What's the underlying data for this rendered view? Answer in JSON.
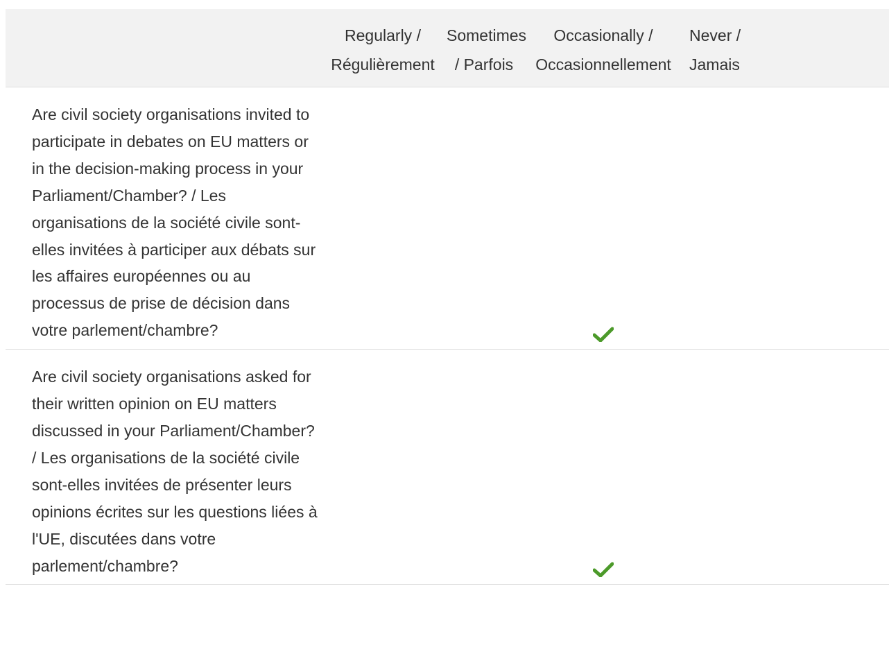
{
  "header": {
    "columns": [
      {
        "line1": "Regularly /",
        "line2": "Régulièrement"
      },
      {
        "line1": "Sometimes",
        "line2": "/ Parfois"
      },
      {
        "line1": "Occasionally /",
        "line2": "Occasionnellement"
      },
      {
        "line1": "Never /",
        "line2": "Jamais"
      }
    ]
  },
  "rows": [
    {
      "question": "Are civil society organisations invited to participate in debates on EU matters or in the decision-making process in your Parliament/Chamber? / Les organisations de la société civile sont-elles invitées à participer aux débats sur les affaires européennes ou au processus de prise de décision dans votre parlement/chambre?",
      "answer": "Occasionally / Occasionnellement"
    },
    {
      "question": "Are civil society organisations asked for their written opinion on EU matters discussed in your Parliament/Chamber? / Les organisations de la société civile sont-elles invitées de présenter leurs opinions écrites sur les questions liées à l'UE, discutées dans votre parlement/chambre?",
      "answer": "Occasionally / Occasionnellement"
    }
  ],
  "icons": {
    "selected": "checkmark-icon",
    "check_color": "#4c9a2a"
  },
  "colors": {
    "header_bg": "#f2f2f2",
    "divider": "#dddddd",
    "text": "#333333"
  }
}
